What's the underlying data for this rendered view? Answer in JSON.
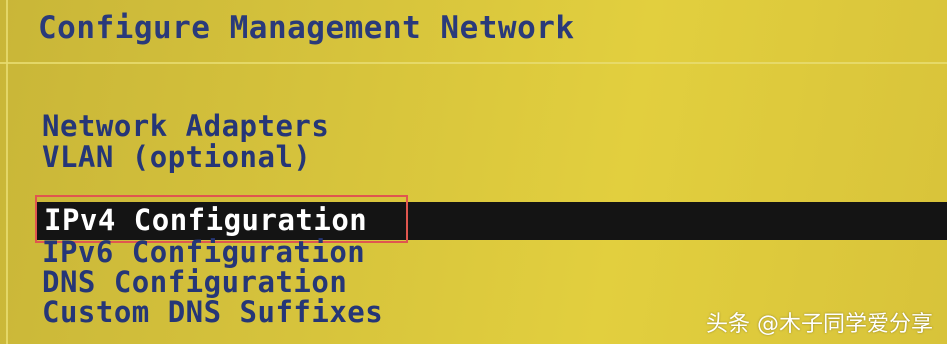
{
  "title": "Configure Management Network",
  "menu": {
    "items": [
      {
        "label": "Network Adapters"
      },
      {
        "label": "VLAN (optional)"
      },
      {
        "label": "IPv4 Configuration"
      },
      {
        "label": "IPv6 Configuration"
      },
      {
        "label": "DNS Configuration"
      },
      {
        "label": "Custom DNS Suffixes"
      }
    ],
    "selected_label": "IPv4 Configuration"
  },
  "watermark": "头条 @木子同学爱分享",
  "colors": {
    "background": "#d6c33c",
    "text": "#253677",
    "selected_bar": "#141414",
    "selected_text": "#ffffff",
    "highlight_box": "#e0564f"
  }
}
